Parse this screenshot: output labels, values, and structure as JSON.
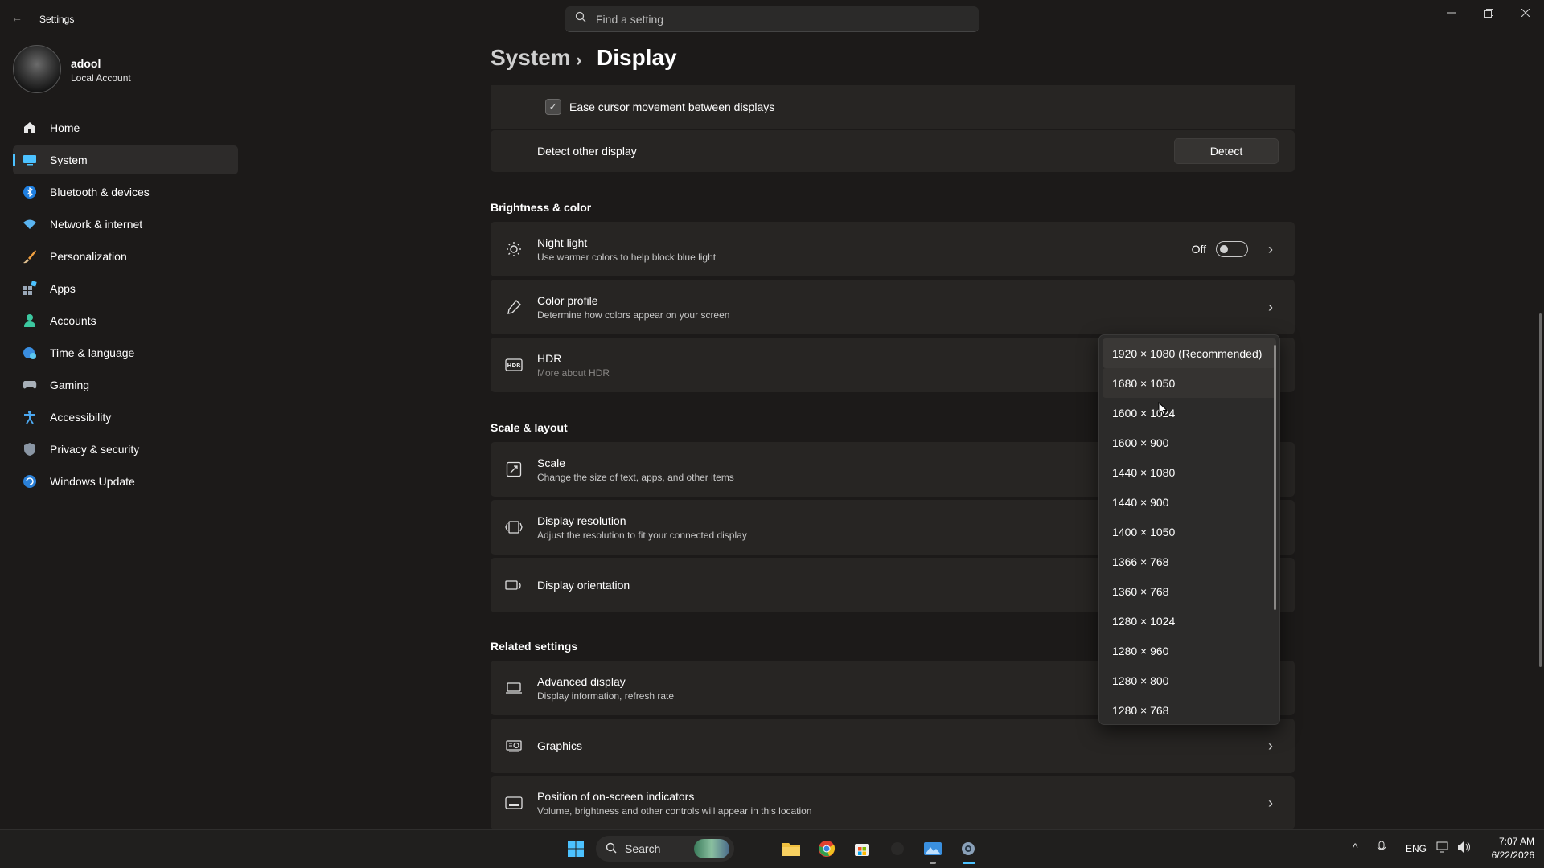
{
  "window": {
    "title": "Settings",
    "controls": [
      "minimize",
      "maximize",
      "close"
    ]
  },
  "search": {
    "placeholder": "Find a setting"
  },
  "profile": {
    "name": "adool",
    "account_type": "Local Account"
  },
  "sidebar": {
    "items": [
      {
        "label": "Home",
        "icon": "home-icon"
      },
      {
        "label": "System",
        "icon": "monitor-icon"
      },
      {
        "label": "Bluetooth & devices",
        "icon": "bluetooth-icon"
      },
      {
        "label": "Network & internet",
        "icon": "wifi-icon"
      },
      {
        "label": "Personalization",
        "icon": "brush-icon"
      },
      {
        "label": "Apps",
        "icon": "apps-icon"
      },
      {
        "label": "Accounts",
        "icon": "person-icon"
      },
      {
        "label": "Time & language",
        "icon": "globe-clock-icon"
      },
      {
        "label": "Gaming",
        "icon": "gamepad-icon"
      },
      {
        "label": "Accessibility",
        "icon": "accessibility-icon"
      },
      {
        "label": "Privacy & security",
        "icon": "shield-icon"
      },
      {
        "label": "Windows Update",
        "icon": "update-icon"
      }
    ],
    "active": "System"
  },
  "breadcrumb": {
    "parent": "System",
    "separator": "›",
    "current": "Display"
  },
  "multi_display": {
    "ease_cursor": {
      "label": "Ease cursor movement between displays",
      "checked": true
    },
    "detect": {
      "label": "Detect other display",
      "button": "Detect"
    }
  },
  "brightness_section": {
    "title": "Brightness & color",
    "night_light": {
      "title": "Night light",
      "subtitle": "Use warmer colors to help block blue light",
      "state": "Off"
    },
    "color_profile": {
      "title": "Color profile",
      "subtitle": "Determine how colors appear on your screen"
    },
    "hdr": {
      "title": "HDR",
      "subtitle": "More about HDR"
    }
  },
  "scale_section": {
    "title": "Scale & layout",
    "scale": {
      "title": "Scale",
      "subtitle": "Change the size of text, apps, and other items"
    },
    "resolution": {
      "title": "Display resolution",
      "subtitle": "Adjust the resolution to fit your connected display"
    },
    "orientation": {
      "title": "Display orientation"
    }
  },
  "related_section": {
    "title": "Related settings",
    "advanced": {
      "title": "Advanced display",
      "subtitle": "Display information, refresh rate"
    },
    "graphics": {
      "title": "Graphics"
    },
    "indicators": {
      "title": "Position of on-screen indicators",
      "subtitle": "Volume, brightness and other controls will appear in this location"
    }
  },
  "resolution_dropdown": {
    "options": [
      "1920 × 1080 (Recommended)",
      "1680 × 1050",
      "1600 × 1024",
      "1600 × 900",
      "1440 × 1080",
      "1440 × 900",
      "1400 × 1050",
      "1366 × 768",
      "1360 × 768",
      "1280 × 1024",
      "1280 × 960",
      "1280 × 800",
      "1280 × 768"
    ],
    "selected": "1920 × 1080 (Recommended)",
    "hovered": "1680 × 1050"
  },
  "taskbar": {
    "search_label": "Search",
    "apps": [
      "start-icon",
      "search-icon",
      "widget-icon",
      "file-explorer-icon",
      "chrome-icon",
      "store-icon",
      "app-icon",
      "photos-icon",
      "settings-icon"
    ],
    "tray": {
      "language": "ENG",
      "time": "7:07 AM",
      "date": "6/22/2026"
    }
  },
  "colors": {
    "accent": "#4cc2ff",
    "background": "#1c1a19",
    "card": "#272523"
  }
}
